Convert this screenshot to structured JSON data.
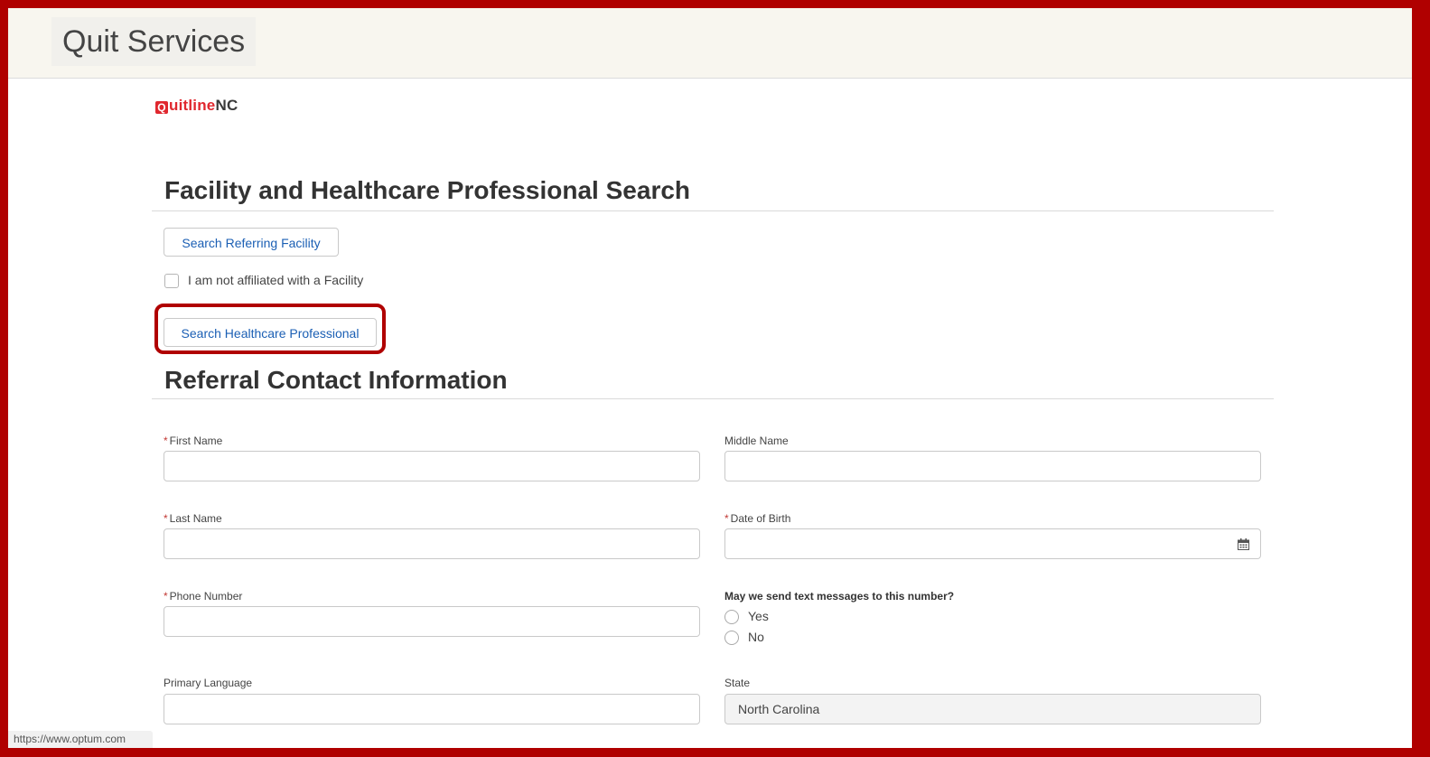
{
  "header": {
    "title": "Quit Services"
  },
  "logo": {
    "first": "Q",
    "second": "uitline",
    "third": "NC"
  },
  "search_section": {
    "title": "Facility and Healthcare Professional Search",
    "search_facility_button": "Search Referring Facility",
    "not_affiliated_label": "I am not affiliated with a Facility",
    "search_professional_button": "Search Healthcare Professional"
  },
  "contact_section": {
    "title": "Referral Contact Information",
    "required_marker": "*",
    "first_name_label": "First Name",
    "middle_name_label": "Middle Name",
    "last_name_label": "Last Name",
    "dob_label": "Date of Birth",
    "phone_label": "Phone Number",
    "text_question": "May we send text messages to this number?",
    "text_options": [
      "Yes",
      "No"
    ],
    "primary_language_label": "Primary Language",
    "state_label": "State",
    "state_value": "North Carolina"
  },
  "status_bar": {
    "url": "https://www.optum.com"
  },
  "colors": {
    "frame_border": "#b00000",
    "link_blue": "#1b5fb4",
    "logo_red": "#e0272e"
  }
}
